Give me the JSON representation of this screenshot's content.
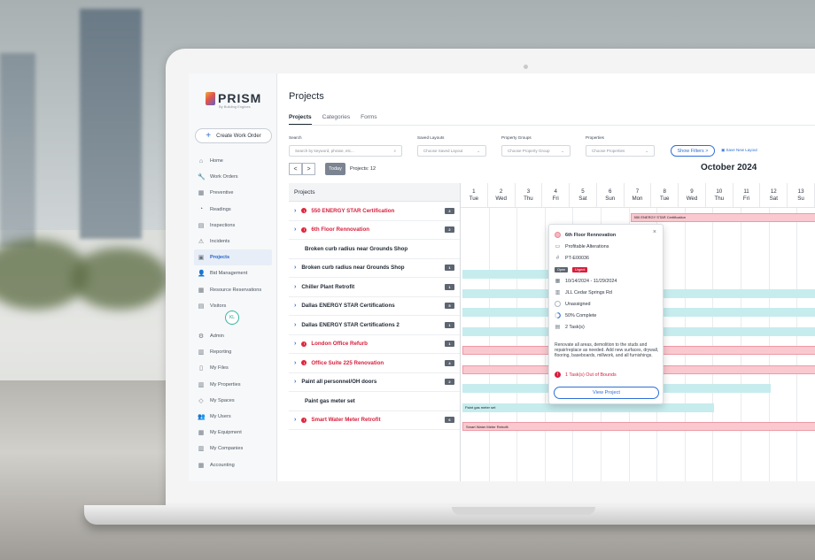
{
  "app": {
    "name": "PRISM",
    "tagline": "By Building Engines"
  },
  "sidebar": {
    "create_button": "Create Work Order",
    "items": [
      {
        "label": "Home",
        "icon": "home-icon",
        "glyph": "⌂"
      },
      {
        "label": "Work Orders",
        "icon": "wrench-icon",
        "glyph": "🔧"
      },
      {
        "label": "Preventive",
        "icon": "calendar-icon",
        "glyph": "▦"
      },
      {
        "label": "Readings",
        "icon": "gauge-icon",
        "glyph": "◔"
      },
      {
        "label": "Inspections",
        "icon": "clipboard-icon",
        "glyph": "▤"
      },
      {
        "label": "Incidents",
        "icon": "alert-icon",
        "glyph": "⚠"
      },
      {
        "label": "Projects",
        "icon": "folder-icon",
        "glyph": "▣"
      },
      {
        "label": "Bid Management",
        "icon": "user-icon",
        "glyph": "👤"
      },
      {
        "label": "Resource Reservations",
        "icon": "calendar-check-icon",
        "glyph": "▦"
      },
      {
        "label": "Visitors",
        "icon": "badge-icon",
        "glyph": "▤"
      }
    ],
    "avatar": "KL",
    "items2": [
      {
        "label": "Admin",
        "icon": "gear-icon",
        "glyph": "⚙"
      },
      {
        "label": "Reporting",
        "icon": "chart-icon",
        "glyph": "▥"
      },
      {
        "label": "My Files",
        "icon": "file-icon",
        "glyph": "▯"
      },
      {
        "label": "My Properties",
        "icon": "building-icon",
        "glyph": "▥"
      },
      {
        "label": "My Spaces",
        "icon": "space-icon",
        "glyph": "◇"
      },
      {
        "label": "My Users",
        "icon": "users-icon",
        "glyph": "👥"
      },
      {
        "label": "My Equipment",
        "icon": "equipment-icon",
        "glyph": "▦"
      },
      {
        "label": "My Companies",
        "icon": "company-icon",
        "glyph": "▥"
      },
      {
        "label": "Accounting",
        "icon": "calculator-icon",
        "glyph": "▦"
      }
    ]
  },
  "header": {
    "title": "Projects",
    "tabs": [
      "Projects",
      "Categories",
      "Forms"
    ]
  },
  "filters": {
    "search_label": "Search",
    "search_placeholder": "Search by keyword, phrase, etc...",
    "layouts_label": "Saved Layouts",
    "layouts_value": "Choose Saved Layout",
    "groups_label": "Property Groups",
    "groups_value": "Choose Property Group",
    "props_label": "Properties",
    "props_value": "Choose Properties",
    "show_filters": "Show Filters  >",
    "save_layout": "Save New Layout"
  },
  "toolbar": {
    "prev": "<",
    "next": ">",
    "today": "Today",
    "count": "Projects: 12"
  },
  "calendar": {
    "month": "October 2024",
    "days": [
      {
        "n": "1",
        "d": "Tue"
      },
      {
        "n": "2",
        "d": "Wed"
      },
      {
        "n": "3",
        "d": "Thu"
      },
      {
        "n": "4",
        "d": "Fri"
      },
      {
        "n": "5",
        "d": "Sat"
      },
      {
        "n": "6",
        "d": "Sun"
      },
      {
        "n": "7",
        "d": "Mon"
      },
      {
        "n": "8",
        "d": "Tue"
      },
      {
        "n": "9",
        "d": "Wed"
      },
      {
        "n": "10",
        "d": "Thu"
      },
      {
        "n": "11",
        "d": "Fri"
      },
      {
        "n": "12",
        "d": "Sat"
      },
      {
        "n": "13",
        "d": "Su"
      }
    ]
  },
  "list": {
    "header": "Projects",
    "rows": [
      {
        "label": "550 ENERGY STAR Certification",
        "red": true,
        "chev": true,
        "alert": true,
        "count": "2"
      },
      {
        "label": "6th Floor Rennovation",
        "red": true,
        "chev": true,
        "alert": true,
        "count": "2"
      },
      {
        "label": "Broken curb radius near Grounds Shop",
        "red": false,
        "chev": false,
        "alert": false,
        "count": ""
      },
      {
        "label": "Broken curb radius near Grounds Shop",
        "red": false,
        "chev": true,
        "alert": false,
        "count": "1"
      },
      {
        "label": "Chiller Plant Retrofit",
        "red": false,
        "chev": true,
        "alert": false,
        "count": "1"
      },
      {
        "label": "Dallas ENERGY STAR Certifications",
        "red": false,
        "chev": true,
        "alert": false,
        "count": "5"
      },
      {
        "label": "Dallas ENERGY STAR Certifications 2",
        "red": false,
        "chev": true,
        "alert": false,
        "count": "1"
      },
      {
        "label": "London Office Refurb",
        "red": true,
        "chev": true,
        "alert": true,
        "count": "1"
      },
      {
        "label": "Office Suite 225 Renovation",
        "red": true,
        "chev": true,
        "alert": true,
        "count": "4"
      },
      {
        "label": "Paint all personnel/OH doors",
        "red": false,
        "chev": true,
        "alert": false,
        "count": "2"
      },
      {
        "label": "Paint gas meter set",
        "red": false,
        "chev": false,
        "alert": false,
        "count": ""
      },
      {
        "label": "Smart Water Meter Retrofit",
        "red": true,
        "chev": true,
        "alert": true,
        "count": "6"
      }
    ]
  },
  "bars": {
    "energy": "550 ENERGY STAR Certification",
    "gas": "Paint gas meter set",
    "water": "Smart Water Meter Retrofit"
  },
  "popup": {
    "title": "6th Floor Rennovation",
    "category": "Profitable Alterations",
    "id": "PT-E00036",
    "status": "Open",
    "priority": "Urgent",
    "dates": "10/14/2024 - 11/29/2024",
    "property": "JLL Cedar Springs Rd",
    "assignee": "Unassigned",
    "progress": "50% Complete",
    "progress_value": 0.5,
    "tasks": "2 Task(s)",
    "description": "Renovate all areas, demolition to the studs and repair/replace as needed. Add new surfaces, drywall, flooring, baseboards, millwork, and all furnishings.",
    "out_of_bounds": "1 Task(s) Out of Bounds",
    "button": "View Project"
  },
  "colors": {
    "accent": "#2e6fd6",
    "danger": "#d81f3c",
    "pinkbar": "#f9c9cf",
    "tealbar": "#c6ecee"
  }
}
